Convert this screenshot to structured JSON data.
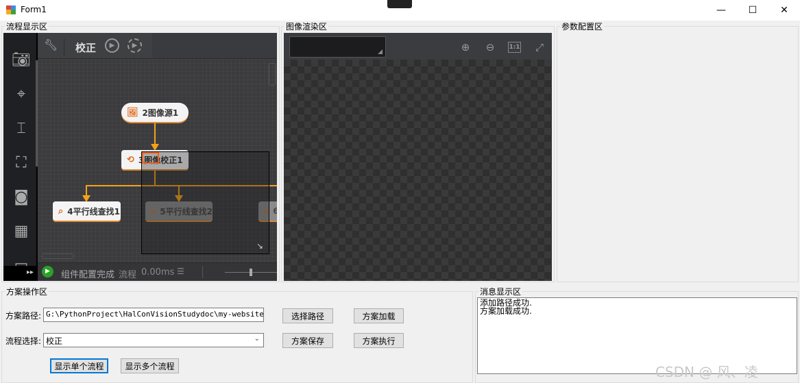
{
  "window": {
    "title": "Form1",
    "controls": [
      "—",
      "☐",
      "✕"
    ]
  },
  "flow_panel": {
    "group_label": "流程显示区",
    "toolbar": {
      "flow_name": "校正"
    },
    "sidebar_icons": [
      "camera-icon",
      "target-icon",
      "measure-icon",
      "focus-icon",
      "calibrate-icon",
      "grid-transform-icon",
      "panel-icon"
    ],
    "nodes": [
      {
        "label": "2图像源1",
        "icon": "image-icon",
        "active": true
      },
      {
        "label": "3图像校正1",
        "icon": "correction-icon",
        "active": true
      },
      {
        "label": "4平行线查找1",
        "icon": "line-search-icon",
        "active": true
      },
      {
        "label": "5平行线查找2",
        "icon": "line-search-icon",
        "active": false
      },
      {
        "label": "6",
        "icon": "line-search-icon",
        "active": false
      }
    ],
    "status": {
      "text": "组件配置完成",
      "flow_label": "流程",
      "time": "0.00ms"
    },
    "accent": "#f5a21a"
  },
  "render_panel": {
    "group_label": "图像渲染区",
    "zoom_labels": {
      "actual_size": "1:1"
    }
  },
  "param_panel": {
    "group_label": "参数配置区"
  },
  "ops_panel": {
    "group_label": "方案操作区",
    "path_label": "方案路径:",
    "path_value": "G:\\PythonProject\\HalConVisionStudydoc\\my-website\\do",
    "flow_label": "流程选择:",
    "flow_value": "校正",
    "buttons": {
      "choose_path": "选择路径",
      "load": "方案加载",
      "save": "方案保存",
      "run": "方案执行",
      "show_single": "显示单个流程",
      "show_multi": "显示多个流程"
    }
  },
  "msg_panel": {
    "group_label": "消息显示区",
    "messages": [
      "添加路径成功.",
      "方案加载成功."
    ]
  },
  "watermark": "CSDN @ 风、凌"
}
